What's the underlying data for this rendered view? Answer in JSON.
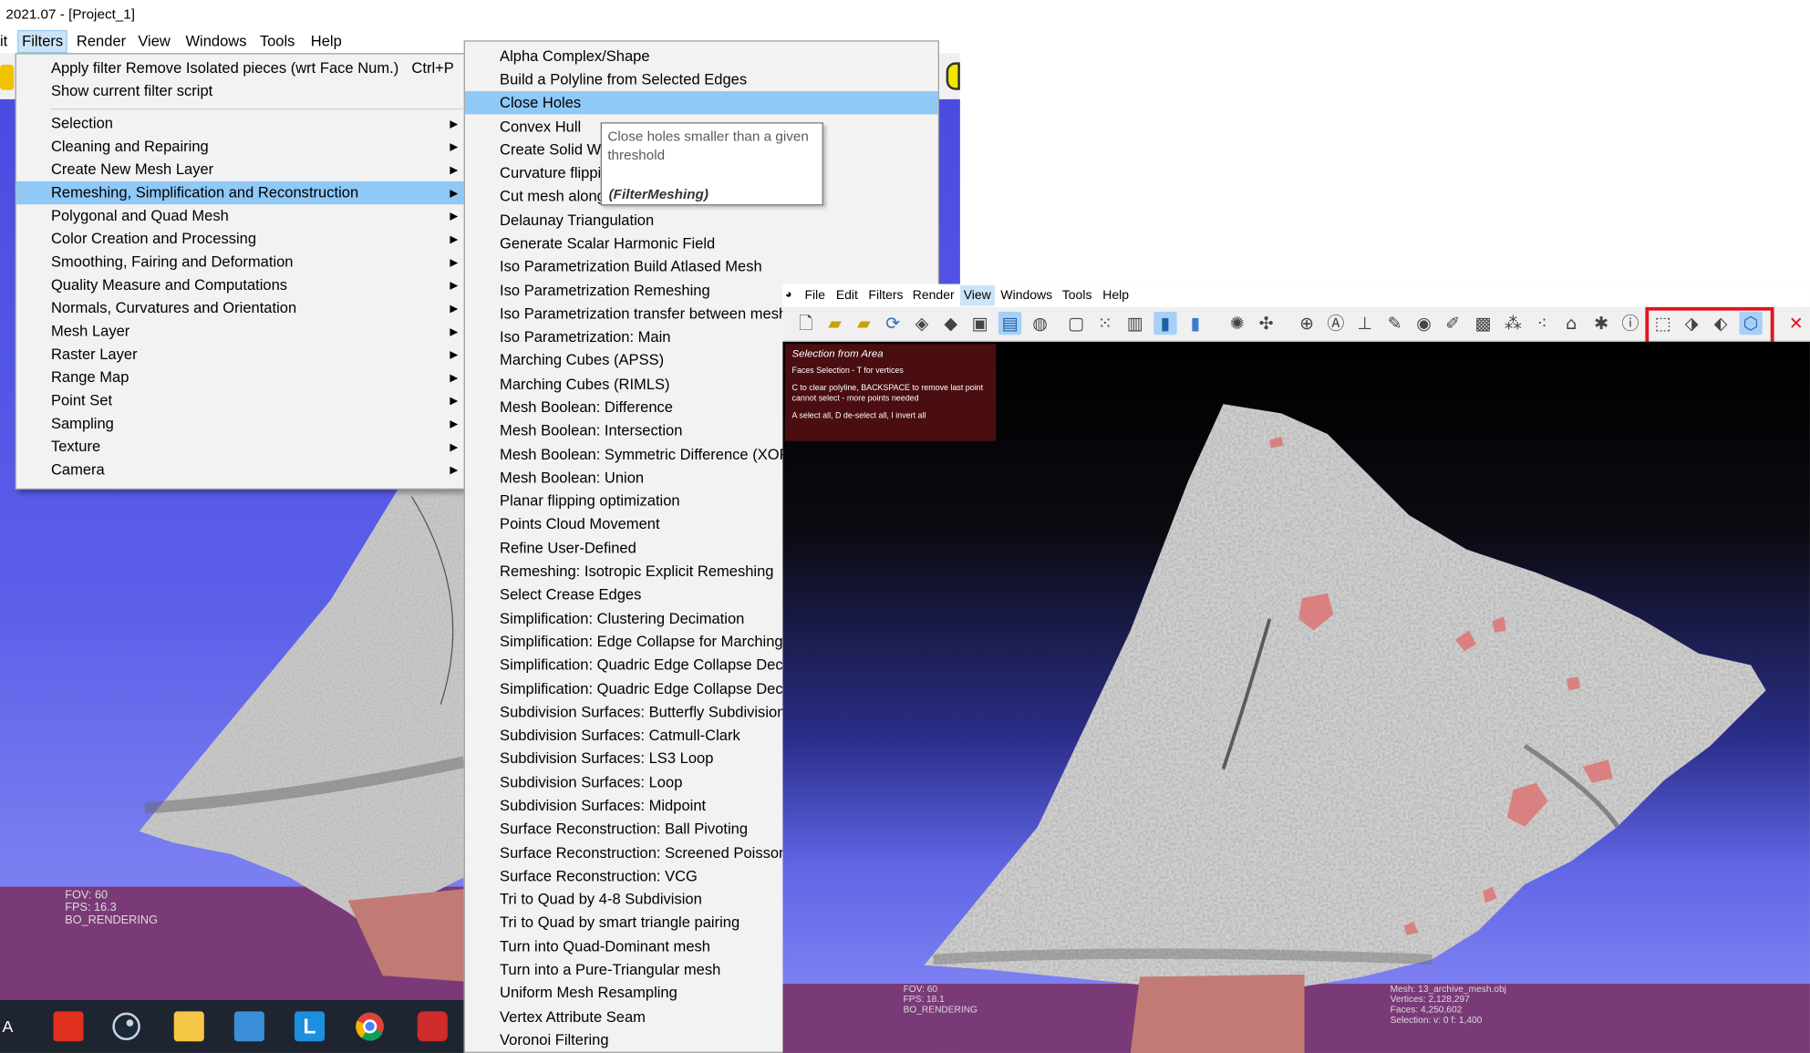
{
  "win1": {
    "title": "2021.07 - [Project_1]",
    "menu": [
      "it",
      "Filters",
      "Render",
      "View",
      "Windows",
      "Tools",
      "Help"
    ],
    "hud": [
      "FOV: 60",
      "FPS:     16.3",
      "BO_RENDERING"
    ]
  },
  "filters_menu": {
    "items": [
      {
        "label": "Apply filter Remove Isolated pieces (wrt Face Num.)",
        "shortcut": "Ctrl+P"
      },
      {
        "label": "Show current filter script"
      },
      {
        "label": "Selection",
        "submenu": true
      },
      {
        "label": "Cleaning and Repairing",
        "submenu": true
      },
      {
        "label": "Create New Mesh Layer",
        "submenu": true
      },
      {
        "label": "Remeshing, Simplification and Reconstruction",
        "submenu": true,
        "highlighted": true
      },
      {
        "label": "Polygonal and Quad Mesh",
        "submenu": true
      },
      {
        "label": "Color Creation and Processing",
        "submenu": true
      },
      {
        "label": "Smoothing, Fairing and Deformation",
        "submenu": true
      },
      {
        "label": "Quality Measure and Computations",
        "submenu": true
      },
      {
        "label": "Normals, Curvatures and Orientation",
        "submenu": true
      },
      {
        "label": "Mesh Layer",
        "submenu": true
      },
      {
        "label": "Raster Layer",
        "submenu": true
      },
      {
        "label": "Range Map",
        "submenu": true
      },
      {
        "label": "Point Set",
        "submenu": true
      },
      {
        "label": "Sampling",
        "submenu": true
      },
      {
        "label": "Texture",
        "submenu": true
      },
      {
        "label": "Camera",
        "submenu": true
      }
    ]
  },
  "submenu": {
    "items": [
      "Alpha Complex/Shape",
      "Build a Polyline from Selected Edges",
      "Close Holes",
      "Convex Hull",
      "Create Solid Wi",
      "Curvature flippi",
      "Cut mesh along",
      "Delaunay Triangulation",
      "Generate Scalar Harmonic Field",
      "Iso Parametrization Build Atlased Mesh",
      "Iso Parametrization Remeshing",
      "Iso Parametrization transfer between meshe",
      "Iso Parametrization: Main",
      "Marching Cubes (APSS)",
      "Marching Cubes (RIMLS)",
      "Mesh Boolean: Difference",
      "Mesh Boolean: Intersection",
      "Mesh Boolean: Symmetric Difference (XOR)",
      "Mesh Boolean: Union",
      "Planar flipping optimization",
      "Points Cloud Movement",
      "Refine User-Defined",
      "Remeshing: Isotropic Explicit Remeshing",
      "Select Crease Edges",
      "Simplification: Clustering Decimation",
      "Simplification: Edge Collapse for Marching",
      "Simplification: Quadric Edge Collapse Deci",
      "Simplification: Quadric Edge Collapse Deci",
      "Subdivision Surfaces: Butterfly Subdivision",
      "Subdivision Surfaces: Catmull-Clark",
      "Subdivision Surfaces: LS3 Loop",
      "Subdivision Surfaces: Loop",
      "Subdivision Surfaces: Midpoint",
      "Surface Reconstruction: Ball Pivoting",
      "Surface Reconstruction: Screened Poisson",
      "Surface Reconstruction: VCG",
      "Tri to Quad by 4-8 Subdivision",
      "Tri to Quad by smart triangle pairing",
      "Turn into Quad-Dominant mesh",
      "Turn into a Pure-Triangular mesh",
      "Uniform Mesh Resampling",
      "Vertex Attribute Seam",
      "Voronoi Filtering"
    ],
    "highlighted_index": 2
  },
  "tooltip": {
    "text": "Close holes smaller than a given threshold",
    "class_name": "(FilterMeshing)"
  },
  "win2": {
    "menu": [
      "File",
      "Edit",
      "Filters",
      "Render",
      "View",
      "Windows",
      "Tools",
      "Help"
    ],
    "active_menu": "View",
    "info": {
      "title": "Selection from Area",
      "line1": "Faces Selection - T for vertices",
      "line2": "C to clear polyline, BACKSPACE to remove last point",
      "line3": "cannot select - more points needed",
      "line4": "A select all, D de-select all, I invert all"
    },
    "hud_left": [
      "FOV: 60",
      "FPS:     18.1",
      "BO_RENDERING"
    ],
    "hud_right": [
      "Mesh: 13_archive_mesh.obj",
      "Vertices: 2,128,297",
      "Faces: 4,250,602",
      "Selection: v: 0 f: 1,400"
    ]
  },
  "colors": {
    "menu_highlight": "#90c8f6",
    "annotation_red": "#e0141e",
    "viewport_blue": "#5a5ee8",
    "floor_purple": "#7a3a78",
    "selection_pink": "#d98080"
  }
}
